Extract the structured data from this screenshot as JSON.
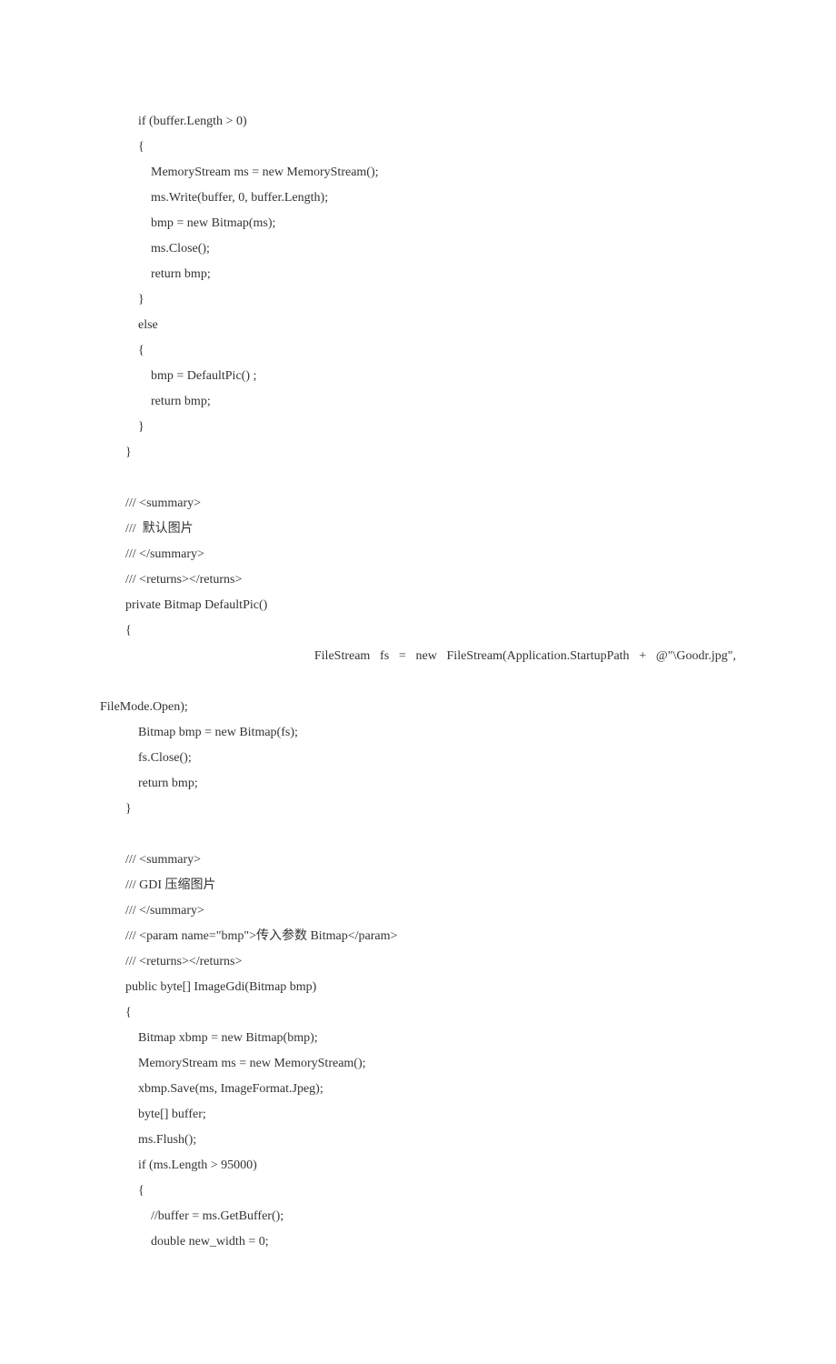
{
  "lines": [
    {
      "t": "            if (buffer.Length > 0)",
      "cls": "code-line"
    },
    {
      "t": "            {",
      "cls": "code-line"
    },
    {
      "t": "                MemoryStream ms = new MemoryStream();",
      "cls": "code-line"
    },
    {
      "t": "                ms.Write(buffer, 0, buffer.Length);",
      "cls": "code-line"
    },
    {
      "t": "                bmp = new Bitmap(ms);",
      "cls": "code-line"
    },
    {
      "t": "                ms.Close();",
      "cls": "code-line"
    },
    {
      "t": "                return bmp;",
      "cls": "code-line"
    },
    {
      "t": "            }",
      "cls": "code-line"
    },
    {
      "t": "            else",
      "cls": "code-line"
    },
    {
      "t": "            {",
      "cls": "code-line"
    },
    {
      "t": "                bmp = DefaultPic() ;",
      "cls": "code-line"
    },
    {
      "t": "                return bmp;",
      "cls": "code-line"
    },
    {
      "t": "            }",
      "cls": "code-line"
    },
    {
      "t": "        }",
      "cls": "code-line"
    },
    {
      "t": "",
      "cls": "code-line"
    },
    {
      "t": "        /// <summary>",
      "cls": "code-line"
    },
    {
      "t": "        ///  默认图片",
      "cls": "code-line"
    },
    {
      "t": "        /// </summary>",
      "cls": "code-line"
    },
    {
      "t": "        /// <returns></returns>",
      "cls": "code-line"
    },
    {
      "t": "        private Bitmap DefaultPic()",
      "cls": "code-line"
    },
    {
      "t": "        {",
      "cls": "code-line"
    },
    {
      "t": "                      FileStream fs = new FileStream(Application.StartupPath + @\"\\Goodr.jpg\",",
      "cls": "justified"
    },
    {
      "t": "FileMode.Open);",
      "cls": "continued"
    },
    {
      "t": "            Bitmap bmp = new Bitmap(fs);",
      "cls": "code-line"
    },
    {
      "t": "            fs.Close();",
      "cls": "code-line"
    },
    {
      "t": "            return bmp;",
      "cls": "code-line"
    },
    {
      "t": "        }",
      "cls": "code-line"
    },
    {
      "t": "",
      "cls": "code-line"
    },
    {
      "t": "        /// <summary>",
      "cls": "code-line"
    },
    {
      "t": "        /// GDI 压缩图片",
      "cls": "code-line"
    },
    {
      "t": "        /// </summary>",
      "cls": "code-line"
    },
    {
      "t": "        /// <param name=\"bmp\">传入参数 Bitmap</param>",
      "cls": "code-line"
    },
    {
      "t": "        /// <returns></returns>",
      "cls": "code-line"
    },
    {
      "t": "        public byte[] ImageGdi(Bitmap bmp)",
      "cls": "code-line"
    },
    {
      "t": "        {",
      "cls": "code-line"
    },
    {
      "t": "            Bitmap xbmp = new Bitmap(bmp);",
      "cls": "code-line"
    },
    {
      "t": "            MemoryStream ms = new MemoryStream();",
      "cls": "code-line"
    },
    {
      "t": "            xbmp.Save(ms, ImageFormat.Jpeg);",
      "cls": "code-line"
    },
    {
      "t": "            byte[] buffer;",
      "cls": "code-line"
    },
    {
      "t": "            ms.Flush();",
      "cls": "code-line"
    },
    {
      "t": "            if (ms.Length > 95000)",
      "cls": "code-line"
    },
    {
      "t": "            {",
      "cls": "code-line"
    },
    {
      "t": "                //buffer = ms.GetBuffer();",
      "cls": "code-line"
    },
    {
      "t": "                double new_width = 0;",
      "cls": "code-line"
    }
  ]
}
